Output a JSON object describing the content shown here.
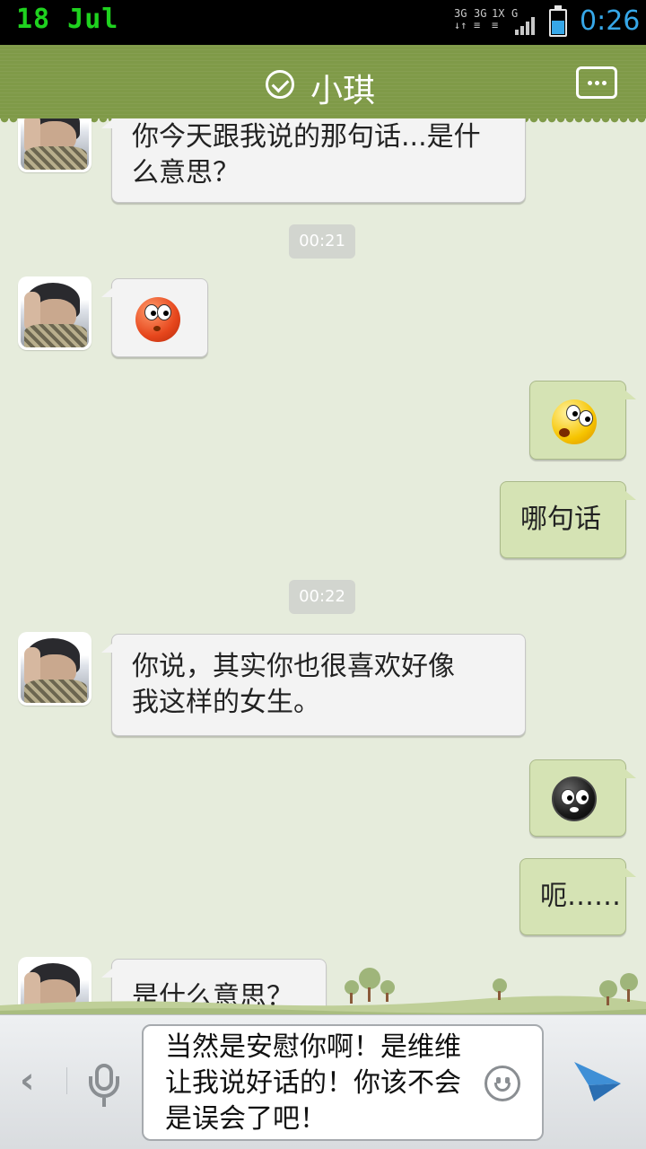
{
  "status_bar": {
    "date": "18 Jul",
    "net_labels": [
      "3G",
      "3G",
      "1X",
      "G"
    ],
    "time": "0:26",
    "time_color": "#36a7e8",
    "date_color": "#1fd21f",
    "battery_level": 0.55
  },
  "title_bar": {
    "contact_name": "小琪",
    "online_icon": "check-circle-icon",
    "more_icon": "more-dots-icon",
    "bar_color": "#7f9a48"
  },
  "chat": {
    "bubble_left_color": "#f3f3f3",
    "bubble_right_color": "#d5e3b4",
    "messages": [
      {
        "side": "left",
        "text": "你今天跟我说的那句话...是什\n么意思？"
      },
      {
        "type": "time",
        "text": "00:21"
      },
      {
        "side": "left",
        "emoji": "blush-emoji-icon"
      },
      {
        "side": "right",
        "emoji": "confused-emoji-icon"
      },
      {
        "side": "right",
        "text": "哪句话"
      },
      {
        "type": "time",
        "text": "00:22"
      },
      {
        "side": "left",
        "text": "你说，其实你也很喜欢好像\n我这样的女生。"
      },
      {
        "side": "right",
        "emoji": "sweat-emoji-icon"
      },
      {
        "side": "right",
        "text": "呃……"
      },
      {
        "side": "left",
        "text": "是什么意思？"
      }
    ]
  },
  "input_bar": {
    "back_icon": "chevron-left-icon",
    "mic_icon": "microphone-icon",
    "draft_text": "当然是安慰你啊！是维维让我说好话的！你该不会是误会了吧！",
    "emoji_icon": "smiley-icon",
    "send_icon": "send-plane-icon"
  }
}
